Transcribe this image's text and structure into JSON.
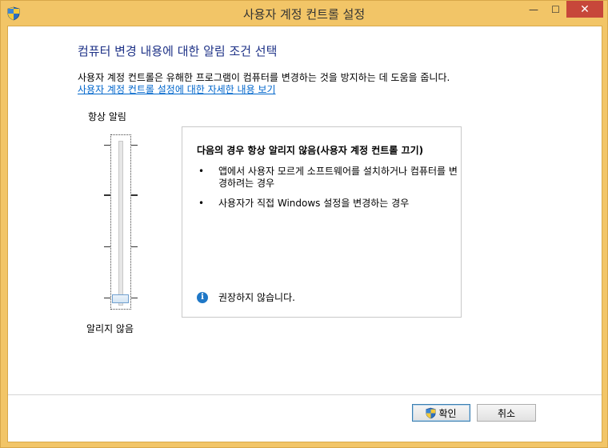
{
  "window": {
    "title": "사용자 계정 컨트롤 설정",
    "controls": {
      "minimize": "—",
      "maximize": "☐",
      "close": "✕"
    }
  },
  "main": {
    "heading": "컴퓨터 변경 내용에 대한 알림 조건 선택",
    "description": "사용자 계정 컨트롤은 유해한 프로그램이 컴퓨터를 변경하는 것을 방지하는 데 도움을 줍니다.",
    "link": "사용자 계정 컨트롤 설정에 대한 자세한 내용 보기"
  },
  "slider": {
    "top_label": "항상 알림",
    "bottom_label": "알리지 않음",
    "levels": 4,
    "selected_level": 4,
    "selected_fraction": 0.0
  },
  "info": {
    "title": "다음의 경우 항상 알리지 않음(사용자 계정 컨트롤 끄기)",
    "bullets": [
      {
        "marker": "•",
        "text": "앱에서 사용자 모르게 소프트웨어를 설치하거나 컴퓨터를 변경하려는 경우"
      },
      {
        "marker": "•",
        "text": "사용자가 직접 Windows 설정을 변경하는 경우"
      }
    ],
    "recommendation_icon": "i",
    "recommendation": "권장하지 않습니다."
  },
  "buttons": {
    "ok": "확인",
    "cancel": "취소"
  },
  "colors": {
    "frame": "#f2c567",
    "close": "#c7473a",
    "heading": "#1e3287",
    "link": "#0066cc",
    "info_icon": "#1f78c7"
  }
}
